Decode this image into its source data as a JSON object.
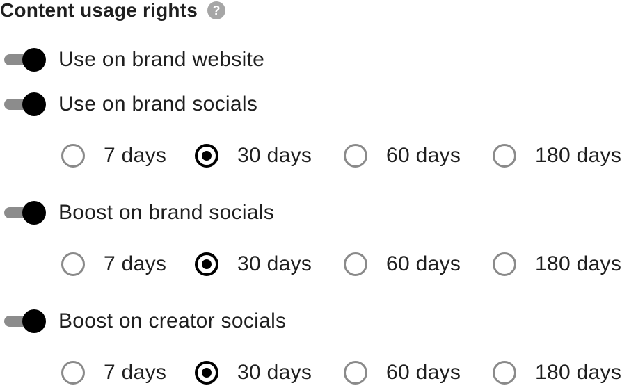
{
  "section": {
    "title": "Content usage rights",
    "help_icon_glyph": "?",
    "help_icon": "question-circle-icon"
  },
  "colors": {
    "text": "#1f1f1f",
    "toggle_on_knob": "#000000",
    "toggle_track": "#8c8c8c",
    "radio_unchecked_border": "#8a8a8a",
    "help_icon_bg": "#a6a6a6"
  },
  "rights": [
    {
      "label": "Use on brand website",
      "enabled": true
    },
    {
      "label": "Use on brand socials",
      "enabled": true,
      "durations": [
        "7 days",
        "30 days",
        "60 days",
        "180 days"
      ],
      "selected": "30 days"
    },
    {
      "label": "Boost on brand socials",
      "enabled": true,
      "durations": [
        "7 days",
        "30 days",
        "60 days",
        "180 days"
      ],
      "selected": "30 days"
    },
    {
      "label": "Boost on creator socials",
      "enabled": true,
      "durations": [
        "7 days",
        "30 days",
        "60 days",
        "180 days"
      ],
      "selected": "30 days"
    }
  ]
}
